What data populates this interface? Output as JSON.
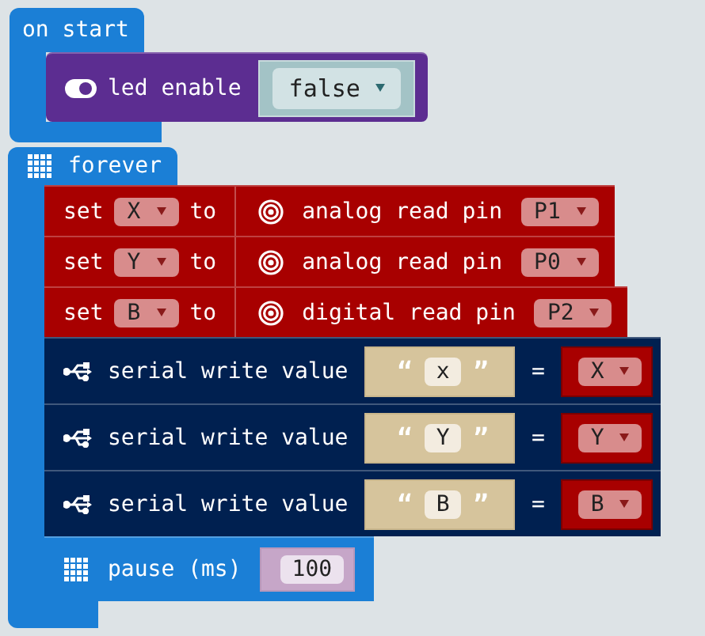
{
  "blocks": [
    {
      "kind": "event",
      "label": "on start",
      "body": [
        {
          "kind": "led",
          "parts": [
            {
              "kind": "text",
              "text": "led enable"
            },
            {
              "kind": "logic",
              "parts": [
                {
                  "kind": "dropdown",
                  "value": "false"
                }
              ]
            }
          ]
        }
      ]
    },
    {
      "kind": "loop",
      "label": "forever",
      "body": [
        {
          "kind": "variables",
          "parts": [
            {
              "kind": "text",
              "text": "set"
            },
            {
              "kind": "dropdown",
              "value": "X"
            },
            {
              "kind": "text",
              "text": "to"
            },
            {
              "kind": "pins",
              "parts": [
                {
                  "kind": "text",
                  "text": "analog read pin"
                },
                {
                  "kind": "dropdown",
                  "value": "P1"
                }
              ]
            }
          ]
        },
        {
          "kind": "variables",
          "parts": [
            {
              "kind": "text",
              "text": "set"
            },
            {
              "kind": "dropdown",
              "value": "Y"
            },
            {
              "kind": "text",
              "text": "to"
            },
            {
              "kind": "pins",
              "parts": [
                {
                  "kind": "text",
                  "text": "analog read pin"
                },
                {
                  "kind": "dropdown",
                  "value": "P0"
                }
              ]
            }
          ]
        },
        {
          "kind": "variables",
          "parts": [
            {
              "kind": "text",
              "text": "set"
            },
            {
              "kind": "dropdown",
              "value": "B"
            },
            {
              "kind": "text",
              "text": "to"
            },
            {
              "kind": "pins",
              "parts": [
                {
                  "kind": "text",
                  "text": "digital read pin"
                },
                {
                  "kind": "dropdown",
                  "value": "P2"
                }
              ]
            }
          ]
        },
        {
          "kind": "serial",
          "parts": [
            {
              "kind": "text",
              "text": "serial write value"
            },
            {
              "kind": "string",
              "open_quote": "“",
              "value": "x",
              "close_quote": "”"
            },
            {
              "kind": "text",
              "text": "="
            },
            {
              "kind": "variables",
              "parts": [
                {
                  "kind": "dropdown",
                  "value": "X"
                }
              ]
            }
          ]
        },
        {
          "kind": "serial",
          "parts": [
            {
              "kind": "text",
              "text": "serial write value"
            },
            {
              "kind": "string",
              "open_quote": "“",
              "value": "Y",
              "close_quote": "”"
            },
            {
              "kind": "text",
              "text": "="
            },
            {
              "kind": "variables",
              "parts": [
                {
                  "kind": "dropdown",
                  "value": "Y"
                }
              ]
            }
          ]
        },
        {
          "kind": "serial",
          "parts": [
            {
              "kind": "text",
              "text": "serial write value"
            },
            {
              "kind": "string",
              "open_quote": "“",
              "value": "B",
              "close_quote": "”"
            },
            {
              "kind": "text",
              "text": "="
            },
            {
              "kind": "variables",
              "parts": [
                {
                  "kind": "dropdown",
                  "value": "B"
                }
              ]
            }
          ]
        },
        {
          "kind": "basic",
          "parts": [
            {
              "kind": "text",
              "text": "pause (ms)"
            },
            {
              "kind": "number",
              "value": "100"
            }
          ]
        }
      ]
    }
  ]
}
